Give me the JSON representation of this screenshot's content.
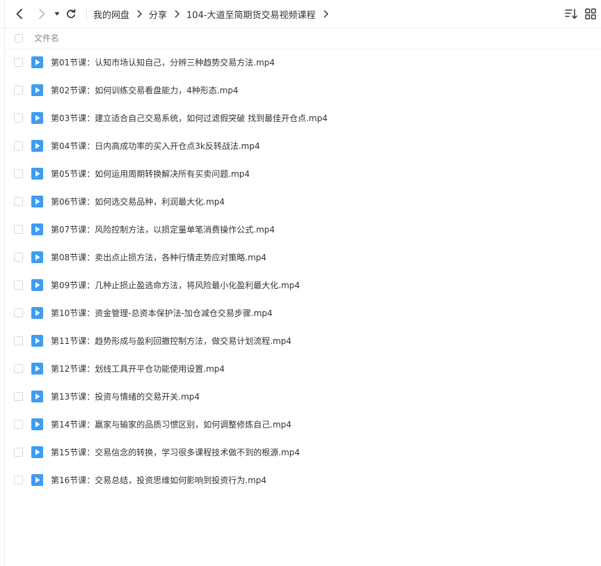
{
  "toolbar": {
    "back_icon": "chevron-left-icon",
    "forward_icon": "chevron-right-icon",
    "history_icon": "caret-down-icon",
    "refresh_icon": "refresh-icon",
    "sort_icon": "sort-icon",
    "grid_icon": "grid-view-icon"
  },
  "breadcrumb": [
    "我的网盘",
    "分享",
    "104-大道至简期货交易视频课程"
  ],
  "list": {
    "header": "文件名",
    "file_icon": "video-file-icon",
    "accent_color": "#3d9cf5",
    "files": [
      "第01节课：认知市场认知自己，分辨三种趋势交易方法.mp4",
      "第02节课：如何训练交易看盘能力，4种形态.mp4",
      "第03节课：建立适合自己交易系统，如何过滤假突破 找到最佳开仓点.mp4",
      "第04节课：日内高成功率的买入开仓点3k反转战法.mp4",
      "第05节课：如何运用周期转换解决所有买卖问题.mp4",
      "第06节课：如何选交易品种，利润最大化.mp4",
      "第07节课：风险控制方法，以损定量单笔消费操作公式.mp4",
      "第08节课：卖出点止损方法，各种行情走势应对策略.mp4",
      "第09节课：几种止损止盈逃命方法，将风险最小化盈利最大化.mp4",
      "第10节课：资金管理-总资本保护法-加仓减仓交易步骤.mp4",
      "第11节课：趋势形成与盈利回撤控制方法，做交易计划流程.mp4",
      "第12节课：划线工具开平仓功能使用设置.mp4",
      "第13节课：投资与情绪的交易开关.mp4",
      "第14节课：赢家与输家的品质习惯区别，如何调整修炼自己.mp4",
      "第15节课：交易信念的转换，学习很多课程技术做不到的根源.mp4",
      "第16节课：交易总结，投资思维如何影响到投资行为.mp4"
    ]
  }
}
